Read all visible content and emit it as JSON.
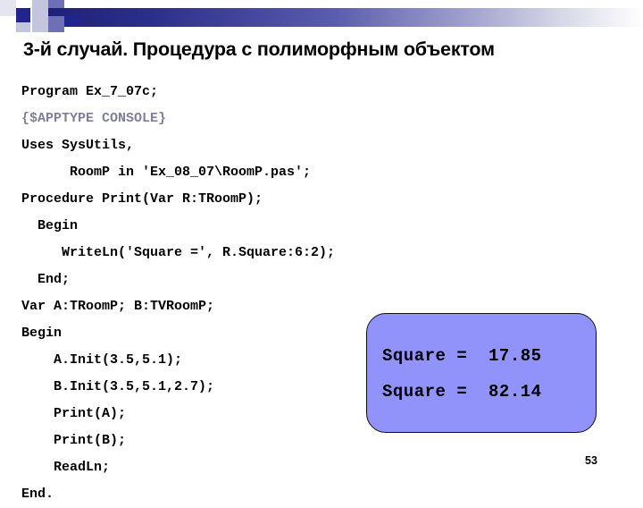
{
  "slide": {
    "title": "3-й случай. Процедура с полиморфным объектом",
    "page_number": "53"
  },
  "header": {
    "accent_dark": "#23238e",
    "accent_mid": "#6e70b5",
    "accent_light": "#c3c4dd",
    "accent_pale": "#e4e5f0",
    "gradient_from": "#1e2078",
    "gradient_to": "#ffffff"
  },
  "code": {
    "directive_color": "#7e7f9c",
    "lines": [
      {
        "text": "Program Ex_7_07c;",
        "style": "normal"
      },
      {
        "text": "{$APPTYPE CONSOLE}",
        "style": "directive"
      },
      {
        "text": "Uses SysUtils,",
        "style": "normal"
      },
      {
        "text": "      RoomP in 'Ex_08_07\\RoomP.pas';",
        "style": "normal"
      },
      {
        "text": "Procedure Print(Var R:TRoomP);",
        "style": "normal"
      },
      {
        "text": "  Begin",
        "style": "normal"
      },
      {
        "text": "     WriteLn('Square =', R.Square:6:2);",
        "style": "normal"
      },
      {
        "text": "  End;",
        "style": "normal"
      },
      {
        "text": "Var A:TRoomP; B:TVRoomP;",
        "style": "normal"
      },
      {
        "text": "Begin",
        "style": "normal"
      },
      {
        "text": "    A.Init(3.5,5.1);",
        "style": "normal"
      },
      {
        "text": "    B.Init(3.5,5.1,2.7);",
        "style": "normal"
      },
      {
        "text": "    Print(A);",
        "style": "normal"
      },
      {
        "text": "    Print(B);",
        "style": "normal"
      },
      {
        "text": "    ReadLn;",
        "style": "normal"
      },
      {
        "text": "End.",
        "style": "normal"
      }
    ]
  },
  "output": {
    "background": "#9292fb",
    "border_color": "#111111",
    "line1": "Square =  17.85",
    "line2": "Square =  82.14"
  }
}
